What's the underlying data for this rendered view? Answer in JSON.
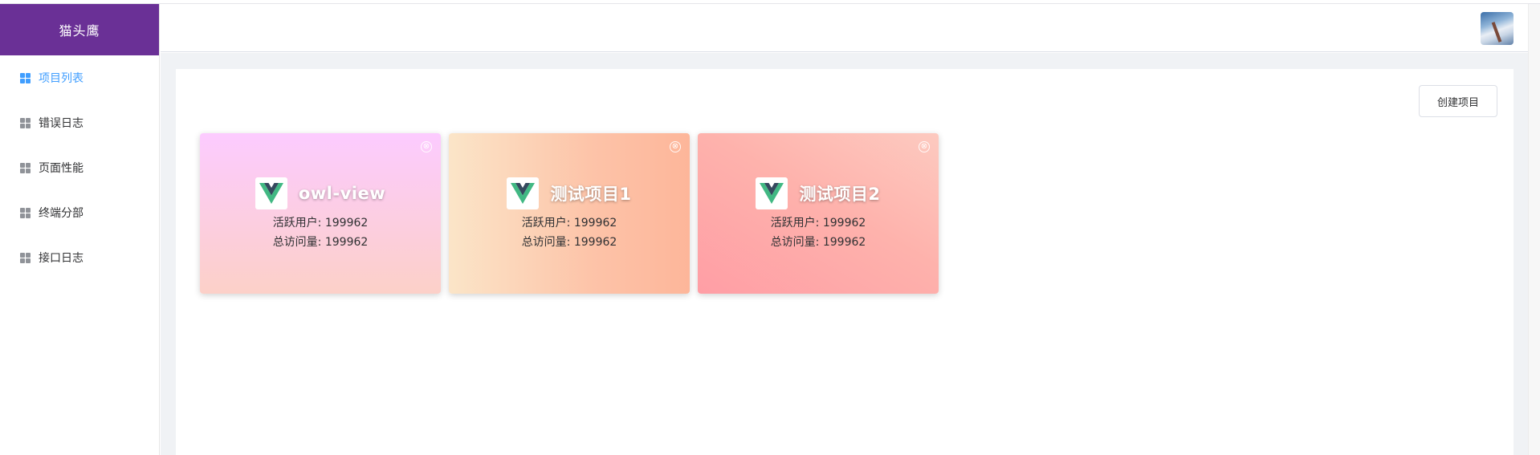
{
  "app": {
    "brand": "猫头鹰"
  },
  "sidebar": {
    "items": [
      {
        "label": "项目列表",
        "active": true
      },
      {
        "label": "错误日志",
        "active": false
      },
      {
        "label": "页面性能",
        "active": false
      },
      {
        "label": "终端分部",
        "active": false
      },
      {
        "label": "接口日志",
        "active": false
      }
    ]
  },
  "header": {
    "avatar": "user-avatar"
  },
  "toolbar": {
    "create_label": "创建项目"
  },
  "projects": [
    {
      "name": "owl-view",
      "active_users": "活跃用户: 199962",
      "total_visits": "总访问量: 199962"
    },
    {
      "name": "测试项目1",
      "active_users": "活跃用户: 199962",
      "total_visits": "总访问量: 199962"
    },
    {
      "name": "测试项目2",
      "active_users": "活跃用户: 199962",
      "total_visits": "总访问量: 199962"
    }
  ],
  "icons": {
    "close": "⊗",
    "menu": "grid-icon",
    "project_logo": "vue-logo-icon"
  },
  "colors": {
    "brand": "#6a3096",
    "active": "#409eff",
    "vue_green": "#41b883",
    "vue_dark": "#35495e"
  }
}
